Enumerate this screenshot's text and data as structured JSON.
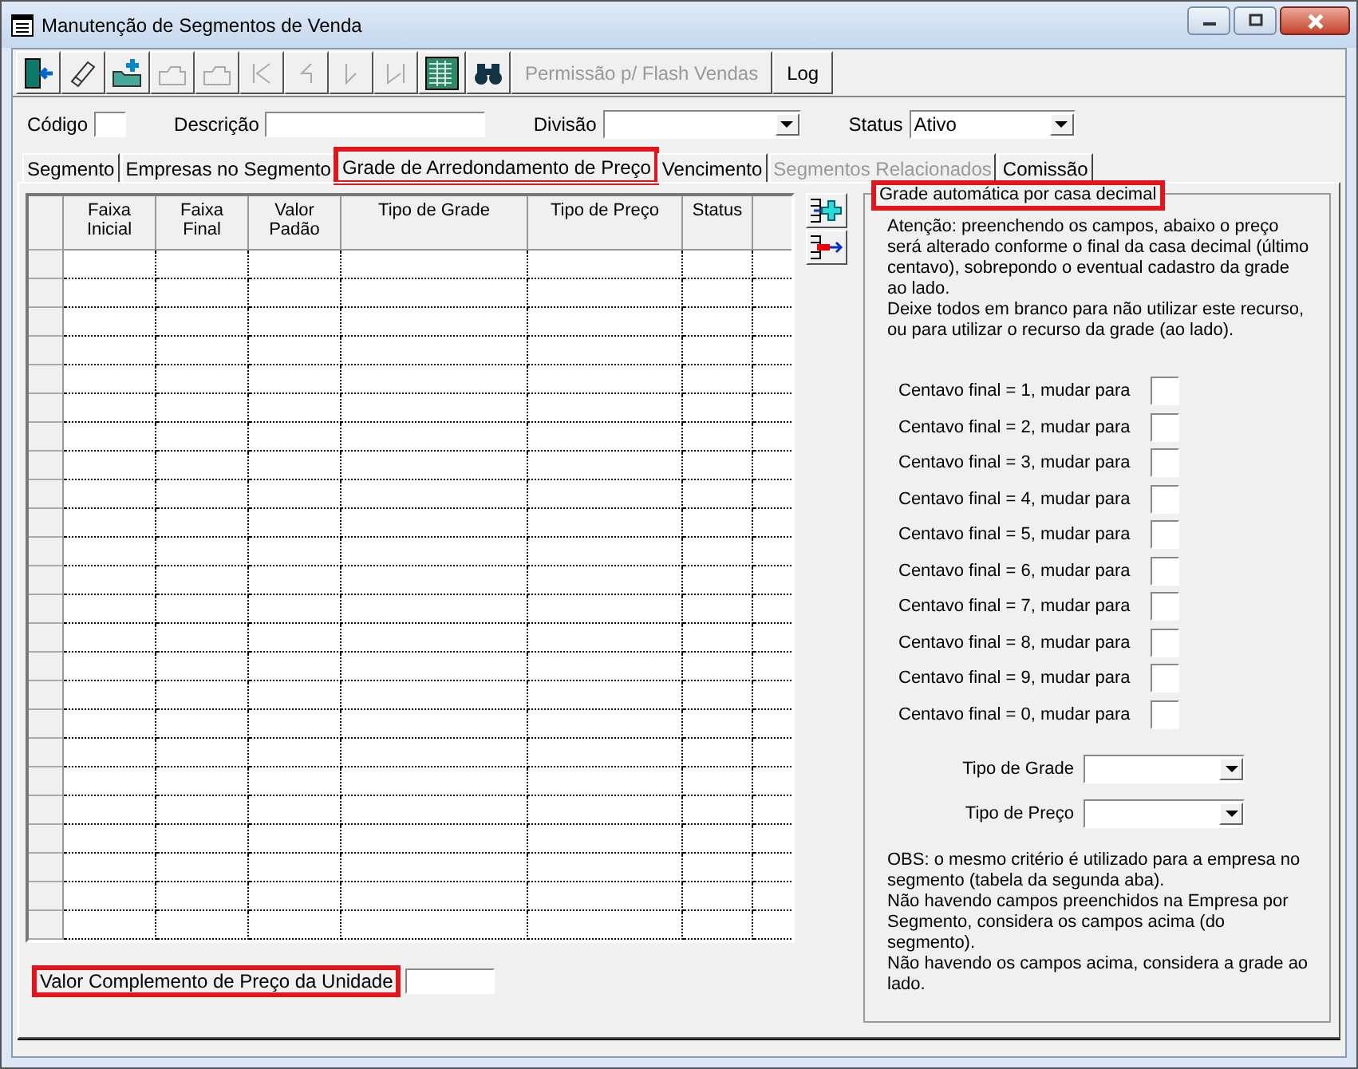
{
  "window": {
    "title": "Manutenção de Segmentos de Venda"
  },
  "toolbar": [
    {
      "kind": "exit",
      "disabled": false
    },
    {
      "kind": "eraser",
      "disabled": false
    },
    {
      "kind": "add",
      "disabled": false
    },
    {
      "kind": "folder",
      "disabled": true
    },
    {
      "kind": "folder",
      "disabled": true
    },
    {
      "kind": "first",
      "disabled": true
    },
    {
      "kind": "prev",
      "disabled": true
    },
    {
      "kind": "next",
      "disabled": true
    },
    {
      "kind": "last",
      "disabled": true
    },
    {
      "kind": "grid",
      "disabled": false
    },
    {
      "kind": "binoculars",
      "disabled": false
    },
    {
      "kind": "text",
      "label": "Permissão p/ Flash Vendas",
      "disabled": true
    },
    {
      "kind": "text",
      "label": "Log",
      "disabled": false
    }
  ],
  "filters": {
    "codigo": {
      "label": "Código"
    },
    "descricao": {
      "label": "Descrição"
    },
    "divisao": {
      "label": "Divisão"
    },
    "status": {
      "label": "Status",
      "value": "Ativo"
    }
  },
  "tabs": [
    {
      "label": "Segmento",
      "selected": false,
      "disabled": false,
      "highlighted": false
    },
    {
      "label": "Empresas no Segmento",
      "selected": false,
      "disabled": false,
      "highlighted": false
    },
    {
      "label": "Grade de Arredondamento de Preço",
      "selected": true,
      "disabled": false,
      "highlighted": true
    },
    {
      "label": "Vencimento",
      "selected": false,
      "disabled": false,
      "highlighted": false
    },
    {
      "label": "Segmentos Relacionados",
      "selected": false,
      "disabled": true,
      "highlighted": false
    },
    {
      "label": "Comissão",
      "selected": false,
      "disabled": false,
      "highlighted": false
    }
  ],
  "grid": {
    "columns": [
      "Faixa Inicial",
      "Faixa Final",
      "Valor Padão",
      "Tipo de Grade",
      "Tipo de Preço",
      "Status"
    ]
  },
  "side_buttons": [
    {
      "kind": "insert"
    },
    {
      "kind": "remove"
    }
  ],
  "auto_grade": {
    "title": "Grade automática por casa decimal",
    "highlighted": true,
    "notes": [
      "Atenção: preenchendo os campos, abaixo o preço será alterado conforme o final da casa decimal (último centavo), sobrepondo o eventual cadastro da grade ao lado.",
      "Deixe todos em branco para não utilizar este recurso, ou para utilizar o recurso da grade (ao lado)."
    ],
    "rules": [
      "Centavo final = 1, mudar para",
      "Centavo final = 2, mudar para",
      "Centavo final = 3, mudar para",
      "Centavo final = 4, mudar para",
      "Centavo final = 5, mudar para",
      "Centavo final = 6, mudar para",
      "Centavo final = 7, mudar para",
      "Centavo final = 8, mudar para",
      "Centavo final = 9, mudar para",
      "Centavo final = 0, mudar para"
    ],
    "selects": [
      "Tipo de Grade",
      "Tipo de Preço"
    ],
    "obs": [
      "OBS: o mesmo critério é utilizado para a empresa no segmento (tabela da segunda aba).",
      "Não havendo campos preenchidos na Empresa por Segmento, considera os campos acima (do segmento).",
      "Não havendo os campos acima, considera a grade ao lado."
    ]
  },
  "complement": {
    "label": "Valor Complemento de Preço da Unidade",
    "highlighted": true
  }
}
